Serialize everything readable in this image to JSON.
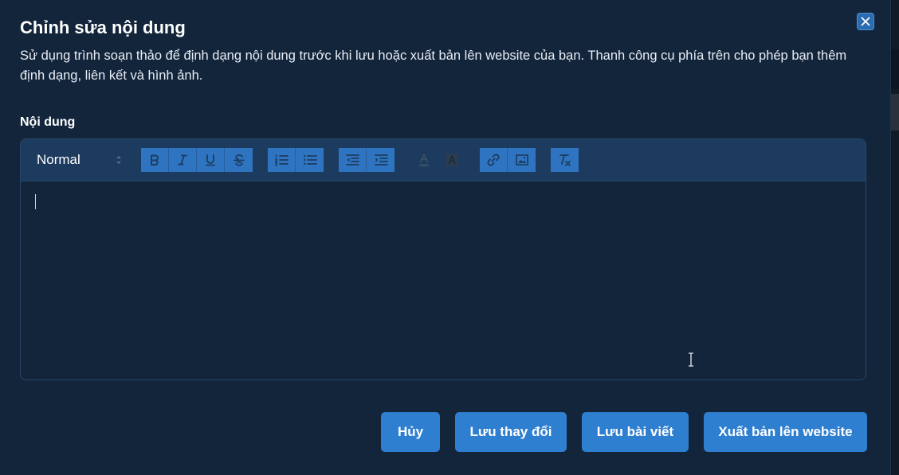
{
  "dialog": {
    "title": "Chỉnh sửa nội dung",
    "description": "Sử dụng trình soạn thảo để định dạng nội dung trước khi lưu hoặc xuất bản lên website của bạn. Thanh công cụ phía trên cho phép bạn thêm định dạng, liên kết và hình ảnh.",
    "close_icon": "close-icon"
  },
  "editor": {
    "label": "Nội dung",
    "format_select": {
      "value": "Normal"
    },
    "toolbar_icons": [
      "bold-icon",
      "italic-icon",
      "underline-icon",
      "strikethrough-icon",
      "ordered-list-icon",
      "bullet-list-icon",
      "outdent-icon",
      "indent-icon",
      "text-color-icon",
      "background-color-icon",
      "link-icon",
      "image-icon",
      "clear-format-icon"
    ],
    "content": ""
  },
  "actions": {
    "cancel_label": "Hủy",
    "save_changes_label": "Lưu thay đổi",
    "save_post_label": "Lưu bài viết",
    "publish_label": "Xuất bản lên website"
  },
  "colors": {
    "modal_bg": "#13253b",
    "toolbar_bg": "#1c3b5e",
    "accent": "#2f7fd1"
  }
}
